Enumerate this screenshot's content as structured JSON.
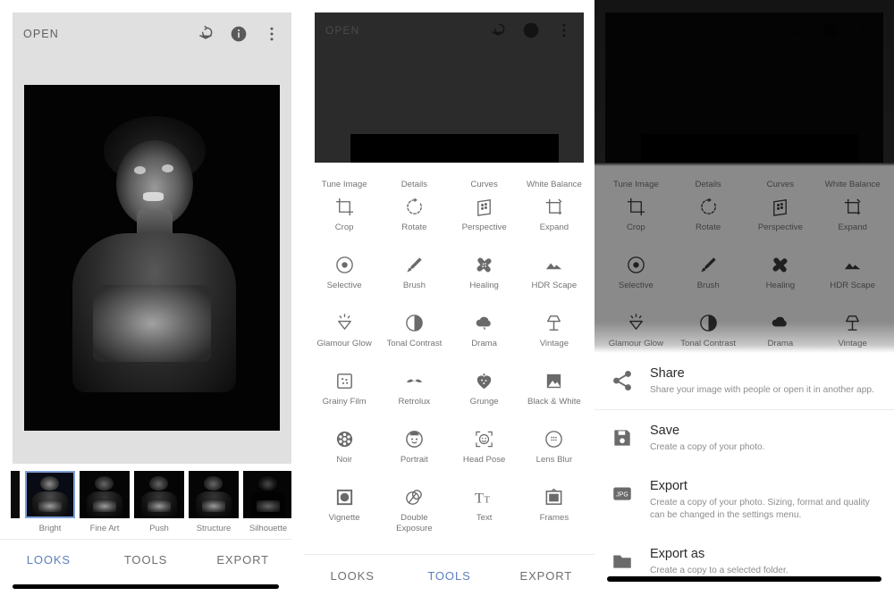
{
  "app": {
    "accent_blue": "#5b7fbd",
    "panel_bg": "#ffffff",
    "toolbar_bg": "#e0e0e0",
    "muted_text": "#757575"
  },
  "panel1": {
    "topbar": {
      "open_label": "OPEN",
      "icons": [
        {
          "name": "layers-undo-icon",
          "glyph": "layers"
        },
        {
          "name": "info-icon",
          "glyph": "info"
        },
        {
          "name": "overflow-menu-icon",
          "glyph": "dots"
        }
      ]
    },
    "photo": {
      "name": "edited-photo",
      "description": "Black and white portrait of a child"
    },
    "looks": [
      {
        "label": "Bright",
        "selected": true
      },
      {
        "label": "Fine Art",
        "selected": false
      },
      {
        "label": "Push",
        "selected": false
      },
      {
        "label": "Structure",
        "selected": false
      },
      {
        "label": "Silhouette",
        "selected": false
      }
    ],
    "tabs": [
      {
        "label": "LOOKS",
        "active": true
      },
      {
        "label": "TOOLS",
        "active": false
      },
      {
        "label": "EXPORT",
        "active": false
      }
    ]
  },
  "panel2": {
    "topbar": {
      "open_label": "OPEN"
    },
    "tools": [
      {
        "label": "Tune Image",
        "icon": "tune-image-icon"
      },
      {
        "label": "Details",
        "icon": "details-icon"
      },
      {
        "label": "Curves",
        "icon": "curves-icon"
      },
      {
        "label": "White Balance",
        "icon": "white-balance-icon"
      },
      {
        "label": "Crop",
        "icon": "crop-icon"
      },
      {
        "label": "Rotate",
        "icon": "rotate-icon"
      },
      {
        "label": "Perspective",
        "icon": "perspective-icon"
      },
      {
        "label": "Expand",
        "icon": "expand-icon"
      },
      {
        "label": "Selective",
        "icon": "selective-icon"
      },
      {
        "label": "Brush",
        "icon": "brush-icon"
      },
      {
        "label": "Healing",
        "icon": "healing-icon"
      },
      {
        "label": "HDR Scape",
        "icon": "hdr-scape-icon"
      },
      {
        "label": "Glamour Glow",
        "icon": "glamour-glow-icon"
      },
      {
        "label": "Tonal Contrast",
        "icon": "tonal-contrast-icon"
      },
      {
        "label": "Drama",
        "icon": "drama-icon"
      },
      {
        "label": "Vintage",
        "icon": "vintage-icon"
      },
      {
        "label": "Grainy Film",
        "icon": "grainy-film-icon"
      },
      {
        "label": "Retrolux",
        "icon": "retrolux-icon"
      },
      {
        "label": "Grunge",
        "icon": "grunge-icon"
      },
      {
        "label": "Black & White",
        "icon": "black-and-white-icon"
      },
      {
        "label": "Noir",
        "icon": "noir-icon"
      },
      {
        "label": "Portrait",
        "icon": "portrait-icon"
      },
      {
        "label": "Head Pose",
        "icon": "head-pose-icon"
      },
      {
        "label": "Lens Blur",
        "icon": "lens-blur-icon"
      },
      {
        "label": "Vignette",
        "icon": "vignette-icon"
      },
      {
        "label": "Double Exposure",
        "icon": "double-exposure-icon"
      },
      {
        "label": "Text",
        "icon": "text-icon"
      },
      {
        "label": "Frames",
        "icon": "frames-icon"
      }
    ],
    "tabs": [
      {
        "label": "LOOKS",
        "active": false
      },
      {
        "label": "TOOLS",
        "active": true
      },
      {
        "label": "EXPORT",
        "active": false
      }
    ]
  },
  "panel3": {
    "export_sheet": [
      {
        "title": "Share",
        "description": "Share your image with people or open it in another app.",
        "icon": "share-icon"
      },
      {
        "title": "Save",
        "description": "Create a copy of your photo.",
        "icon": "save-floppy-icon"
      },
      {
        "title": "Export",
        "description": "Create a copy of your photo. Sizing, format and quality can be changed in the settings menu.",
        "icon": "jpg-export-icon"
      },
      {
        "title": "Export as",
        "description": "Create a copy to a selected folder.",
        "icon": "folder-icon"
      }
    ]
  }
}
